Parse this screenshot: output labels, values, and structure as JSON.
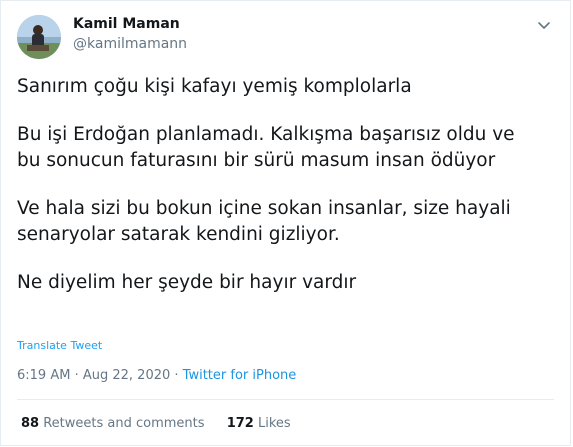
{
  "author": {
    "name": "Kamil Maman",
    "handle": "@kamilmamann"
  },
  "tweet": {
    "paragraphs": [
      "Sanırım çoğu kişi kafayı yemiş komplolarla",
      "Bu işi Erdoğan planlamadı. Kalkışma başarısız oldu ve\nbu sonucun faturasını bir sürü masum insan ödüyor",
      "Ve hala sizi bu bokun içine sokan insanlar, size hayali\nsenaryolar satarak kendini gizliyor.",
      "Ne diyelim her şeyde bir hayır vardır"
    ],
    "translate_label": "Translate Tweet"
  },
  "meta": {
    "time": "6:19 AM",
    "separator1": " · ",
    "date": "Aug 22, 2020",
    "separator2": " · ",
    "source": "Twitter for iPhone"
  },
  "stats": {
    "retweets_count": "88",
    "retweets_label": "Retweets and comments",
    "likes_count": "172",
    "likes_label": "Likes"
  },
  "icons": {
    "more": "chevron-down-icon",
    "avatar": "avatar"
  },
  "colors": {
    "link": "#1da1f2",
    "muted": "#657786",
    "text": "#14171a",
    "border": "#e6ecf0"
  }
}
